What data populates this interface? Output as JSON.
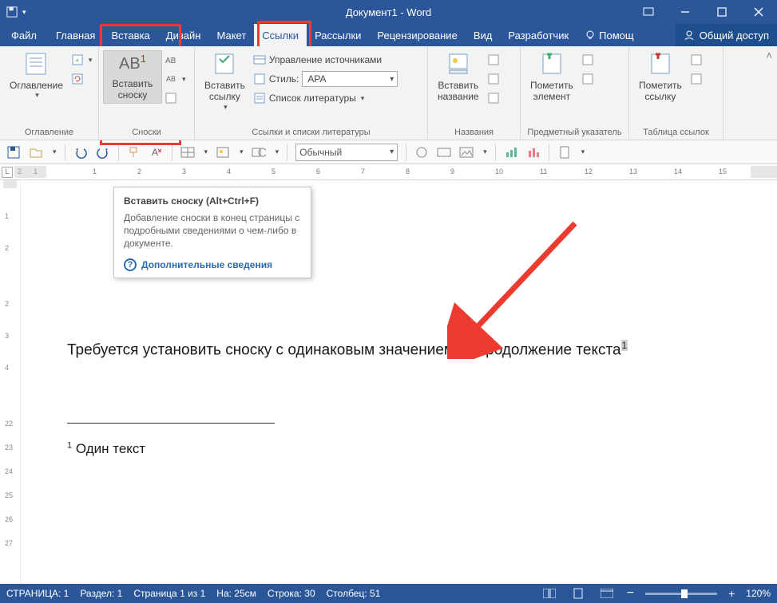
{
  "titlebar": {
    "title": "Документ1 - Word"
  },
  "tabs": {
    "file": "Файл",
    "items": [
      "Главная",
      "Вставка",
      "Дизайн",
      "Макет",
      "Ссылки",
      "Рассылки",
      "Рецензирование",
      "Вид",
      "Разработчик"
    ],
    "active_index": 4,
    "help": "Помощ",
    "share": "Общий доступ"
  },
  "ribbon": {
    "toc": {
      "btn": "Оглавление",
      "group": "Оглавление"
    },
    "footnotes": {
      "insert": "Вставить\nсноску",
      "ab": "AB",
      "group": "Сноски"
    },
    "citations": {
      "insert": "Вставить\nссылку",
      "manage": "Управление источниками",
      "style_label": "Стиль:",
      "style_value": "APA",
      "biblio": "Список литературы",
      "group": "Ссылки и списки литературы"
    },
    "captions": {
      "insert": "Вставить\nназвание",
      "group": "Названия"
    },
    "index": {
      "mark": "Пометить\nэлемент",
      "group": "Предметный указатель"
    },
    "toa": {
      "mark": "Пометить\nссылку",
      "group": "Таблица ссылок"
    }
  },
  "qat2": {
    "style": "Обычный"
  },
  "tooltip": {
    "title": "Вставить сноску (Alt+Ctrl+F)",
    "body": "Добавление сноски в конец страницы с подробными сведениями о чем-либо в документе.",
    "more": "Дополнительные сведения"
  },
  "document": {
    "line_part1": "Требуется установить сноску с одинаковым значением",
    "sup1": "1",
    "line_part2": " и продолжение текста",
    "sup2": "1",
    "footnote_num": "1",
    "footnote_text": " Один текст"
  },
  "ruler": {
    "h_numbers": [
      "2",
      "1",
      "1",
      "2",
      "3",
      "4",
      "5",
      "6",
      "7",
      "8",
      "9",
      "10",
      "11",
      "12",
      "13",
      "14",
      "15"
    ],
    "v_numbers": [
      "1",
      "2",
      "2",
      "3",
      "4",
      "22",
      "23",
      "24",
      "25",
      "26",
      "27"
    ]
  },
  "status": {
    "page": "СТРАНИЦА: 1",
    "section": "Раздел: 1",
    "page_of": "Страница 1 из 1",
    "at": "На: 25см",
    "line": "Строка: 30",
    "col": "Столбец: 51",
    "zoom": "120%"
  }
}
